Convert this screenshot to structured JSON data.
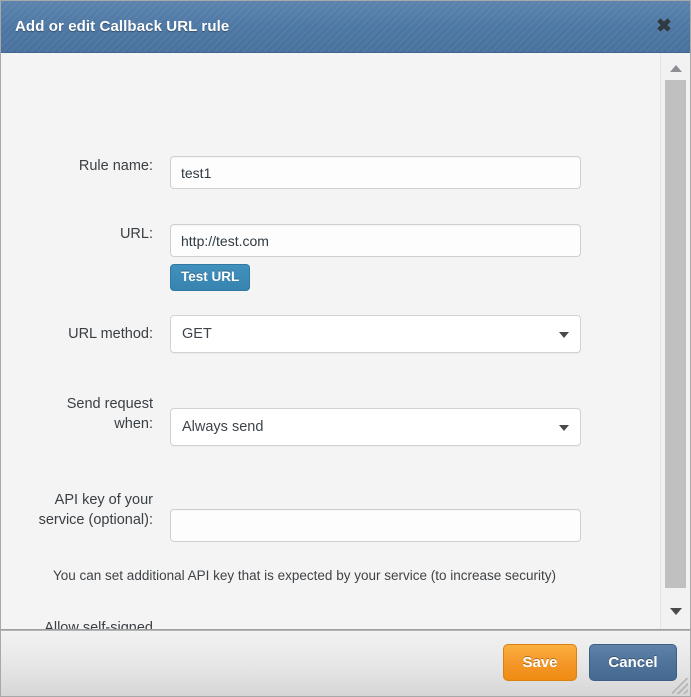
{
  "dialog": {
    "title": "Add or edit Callback URL rule",
    "close_icon": "close-icon"
  },
  "form": {
    "rule_name": {
      "label": "Rule name:",
      "value": "test1",
      "placeholder": ""
    },
    "url": {
      "label": "URL:",
      "value": "http://test.com",
      "placeholder": ""
    },
    "test_url_button": "Test URL",
    "url_method": {
      "label": "URL method:",
      "value": "GET"
    },
    "send_request_when": {
      "label": "Send request\nwhen:",
      "value": "Always send"
    },
    "api_key": {
      "label": "API key of your\nservice (optional):",
      "value": "",
      "placeholder": ""
    },
    "api_key_help": "You can set additional API key that is expected by your service (to increase security)",
    "allow_self_signed": {
      "label": "Allow self-signed\nSSL certificate:",
      "checked": false
    }
  },
  "footer": {
    "save_label": "Save",
    "cancel_label": "Cancel"
  },
  "scrollbar": {
    "up_icon": "caret-up-icon",
    "down_icon": "caret-down-icon"
  },
  "colors": {
    "titlebar": "#4c76a3",
    "save": "#f5982a",
    "cancel": "#4f739b",
    "test_url": "#3884b0",
    "body_bg": "#f4f4f4"
  }
}
